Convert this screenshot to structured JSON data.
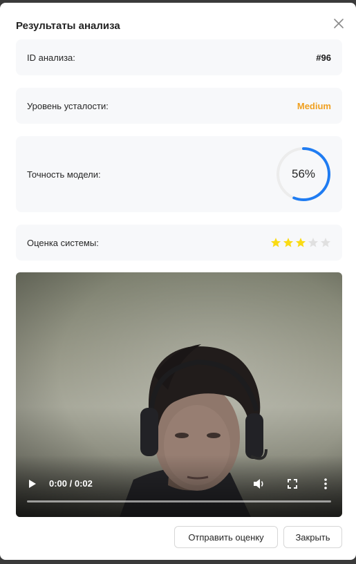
{
  "modal": {
    "title": "Результаты анализа"
  },
  "results": {
    "analysis_id_label": "ID анализа:",
    "analysis_id_value": "#96",
    "fatigue_label": "Уровень усталости:",
    "fatigue_value": "Medium",
    "fatigue_color": "#f0a020",
    "accuracy_label": "Точность модели:",
    "accuracy_percent": 56,
    "accuracy_text": "56%",
    "accuracy_color": "#1f7cf2",
    "rating_label": "Оценка системы:",
    "rating_value": 3,
    "rating_max": 5,
    "star_filled_color": "#fadb14",
    "star_empty_color": "#e0e0e0"
  },
  "video": {
    "time_display": "0:00 / 0:02",
    "icons": [
      "play-icon",
      "volume-icon",
      "fullscreen-icon",
      "more-options-icon"
    ]
  },
  "footer": {
    "submit_label": "Отправить оценку",
    "close_label": "Закрыть"
  }
}
